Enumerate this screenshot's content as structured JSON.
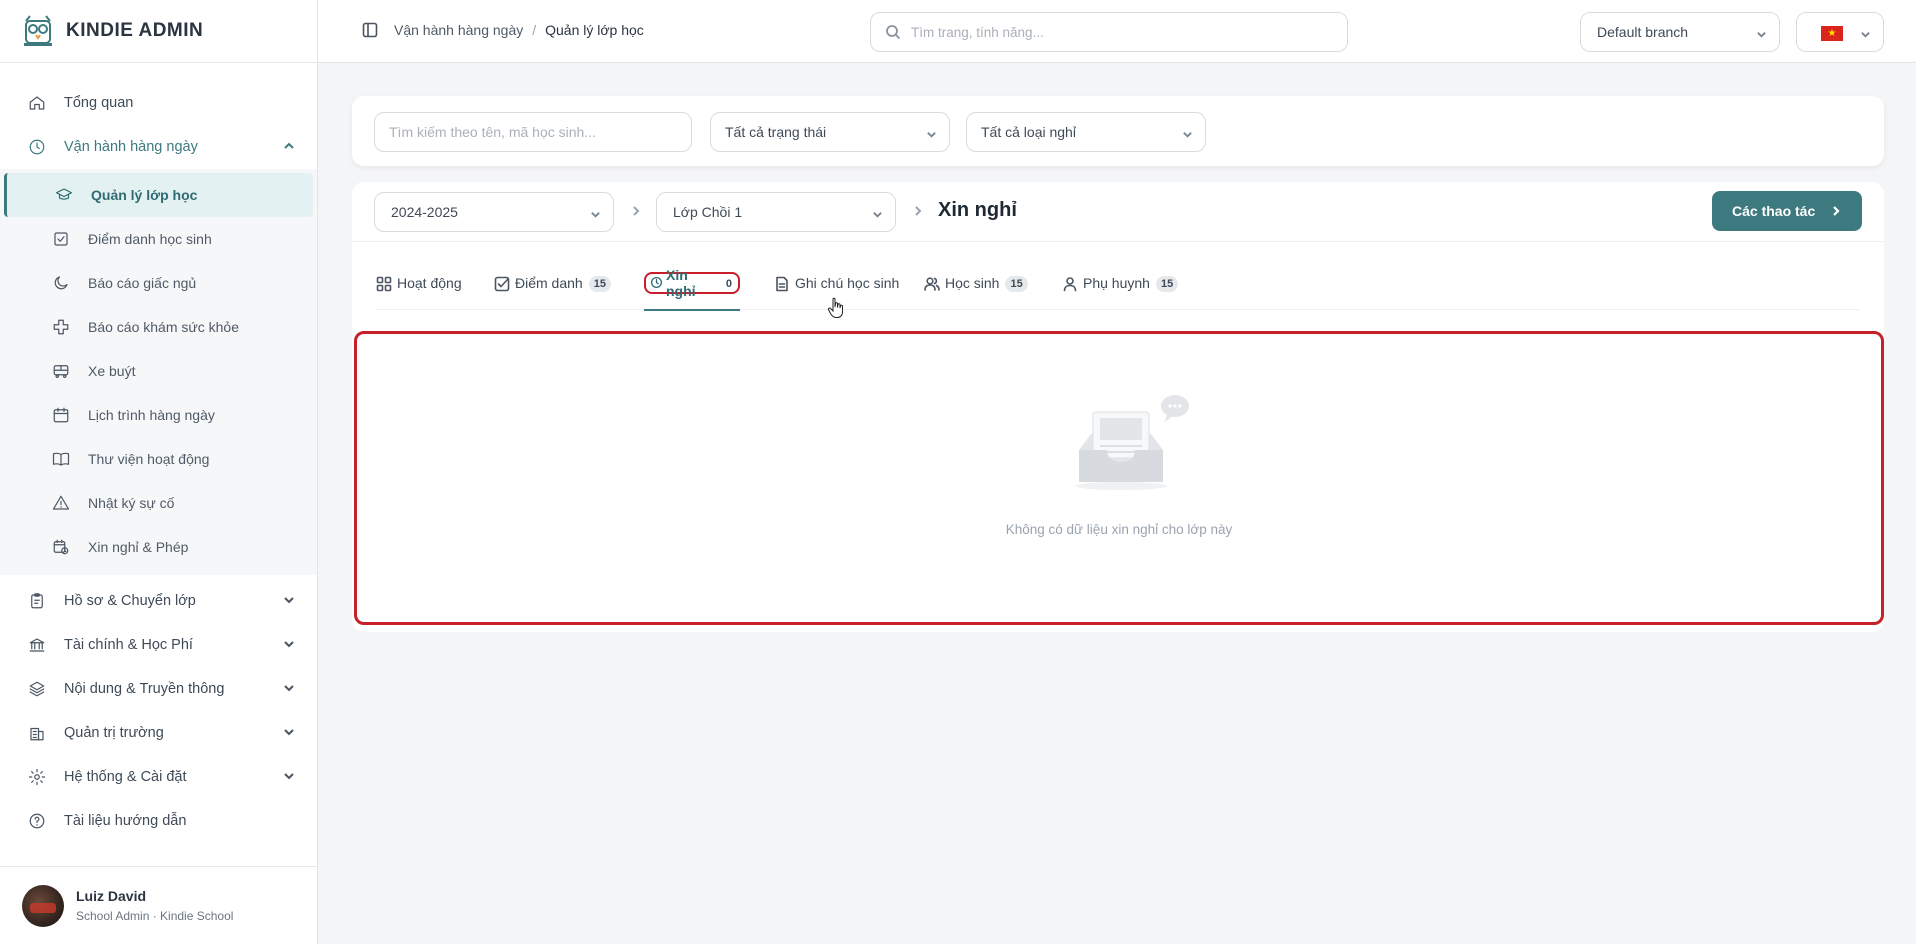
{
  "brand": {
    "name": "KINDIE ADMIN"
  },
  "sidebar": {
    "items": [
      {
        "label": "Tổng quan",
        "icon": "home-icon"
      },
      {
        "label": "Vận hành hàng ngày",
        "icon": "clock-icon",
        "open": true
      }
    ],
    "subitems": [
      {
        "label": "Quản lý lớp học",
        "icon": "graduation-cap-icon",
        "active": true
      },
      {
        "label": "Điểm danh học sinh",
        "icon": "check-square-icon"
      },
      {
        "label": "Báo cáo giấc ngủ",
        "icon": "moon-icon"
      },
      {
        "label": "Báo cáo khám sức khỏe",
        "icon": "medical-cross-icon"
      },
      {
        "label": "Xe buýt",
        "icon": "bus-icon"
      },
      {
        "label": "Lịch trình hàng ngày",
        "icon": "calendar-icon"
      },
      {
        "label": "Thư viện hoạt động",
        "icon": "book-icon"
      },
      {
        "label": "Nhật ký sự cố",
        "icon": "warning-icon"
      },
      {
        "label": "Xin nghỉ & Phép",
        "icon": "calendar-clock-icon"
      }
    ],
    "groups": [
      {
        "label": "Hồ sơ & Chuyển lớp",
        "icon": "clipboard-icon"
      },
      {
        "label": "Tài chính & Học Phí",
        "icon": "bank-icon"
      },
      {
        "label": "Nội dung & Truyền thông",
        "icon": "layers-icon"
      },
      {
        "label": "Quản trị trường",
        "icon": "building-icon"
      },
      {
        "label": "Hệ thống & Cài đặt",
        "icon": "gear-icon"
      },
      {
        "label": "Tài liệu hướng dẫn",
        "icon": "help-circle-icon"
      }
    ]
  },
  "user": {
    "name": "Luiz David",
    "role": "School Admin · Kindie School"
  },
  "header": {
    "breadcrumb": [
      "Vận hành hàng ngày",
      "Quản lý lớp học"
    ],
    "search_placeholder": "Tìm trang, tính năng...",
    "branch": "Default branch",
    "language_flag": "vietnam-flag-icon"
  },
  "filters": {
    "search_placeholder": "Tìm kiếm theo tên, mã học sinh...",
    "status": "Tất cả trạng thái",
    "leave_type": "Tất cả loại nghỉ"
  },
  "toolbar": {
    "year": "2024-2025",
    "class": "Lớp Chồi 1",
    "title": "Xin nghỉ",
    "actions_label": "Các thao tác"
  },
  "tabs": [
    {
      "label": "Hoạt động",
      "icon": "grid-icon",
      "count": ""
    },
    {
      "label": "Điểm danh",
      "icon": "check-square-icon",
      "count": "15"
    },
    {
      "label": "Xin nghỉ",
      "icon": "clock-icon",
      "count": "0",
      "active": true
    },
    {
      "label": "Ghi chú học sinh",
      "icon": "document-icon",
      "count": ""
    },
    {
      "label": "Học sinh",
      "icon": "users-icon",
      "count": "15"
    },
    {
      "label": "Phụ huynh",
      "icon": "user-icon",
      "count": "15"
    }
  ],
  "empty": {
    "message": "Không có dữ liệu xin nghỉ cho lớp này"
  },
  "colors": {
    "accent": "#3d7a80",
    "highlight": "#c8202a"
  }
}
